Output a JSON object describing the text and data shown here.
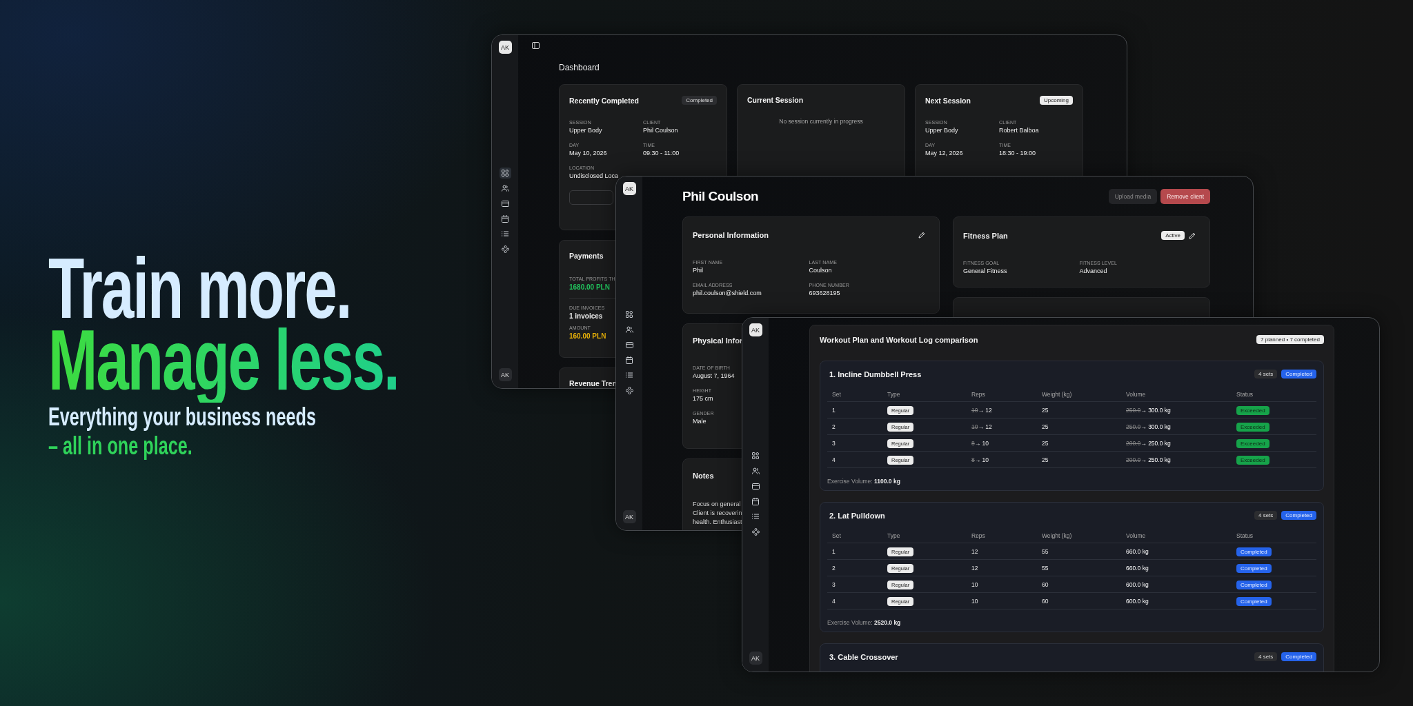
{
  "hero": {
    "headline": "Train more.",
    "headline_accent": "Manage less.",
    "tagline": "Everything your business needs",
    "tagline_accent": "– all in one place."
  },
  "dashboard_window": {
    "avatar": "AK",
    "footer_avatar": "AK",
    "nav": [
      {
        "kind": "grid",
        "selected": true
      },
      {
        "kind": "users",
        "selected": false
      },
      {
        "kind": "card",
        "selected": false
      },
      {
        "kind": "calendar",
        "selected": false
      },
      {
        "kind": "list",
        "selected": false
      },
      {
        "kind": "nodes",
        "selected": false
      }
    ],
    "title": "Dashboard",
    "session_cards": [
      {
        "title": "Recently Completed",
        "badge": {
          "label": "Completed",
          "kind": "neutral"
        },
        "fields": [
          {
            "label": "SESSION",
            "value": "Upper Body"
          },
          {
            "label": "CLIENT",
            "value": "Phil Coulson"
          },
          {
            "label": "DAY",
            "value": "May 10, 2026"
          },
          {
            "label": "TIME",
            "value": "09:30 - 11:00"
          },
          {
            "label": "LOCATION",
            "value": "Undisclosed Loca"
          }
        ],
        "action_button": true
      },
      {
        "title": "Current Session",
        "empty_text": "No session currently in progress"
      },
      {
        "title": "Next Session",
        "badge": {
          "label": "Upcoming",
          "kind": "light"
        },
        "fields": [
          {
            "label": "SESSION",
            "value": "Upper Body"
          },
          {
            "label": "CLIENT",
            "value": "Robert Balboa"
          },
          {
            "label": "DAY",
            "value": "May 12, 2026"
          },
          {
            "label": "TIME",
            "value": "18:30 - 19:00"
          }
        ]
      }
    ],
    "payments": {
      "title": "Payments",
      "groups": [
        [
          {
            "label": "TOTAL PROFITS TH",
            "value": "1680.00 PLN",
            "color": "#22c55e"
          }
        ],
        [
          {
            "label": "DUE INVOICES",
            "value": "1 invoices"
          },
          {
            "label": "AMOUNT",
            "value": "160.00 PLN",
            "color": "#eab308"
          }
        ]
      ]
    },
    "revenue": {
      "title": "Revenue Tren"
    }
  },
  "client_window": {
    "avatar": "AK",
    "footer_avatar": "AK",
    "nav": [
      {
        "kind": "grid",
        "selected": false
      },
      {
        "kind": "users",
        "selected": false
      },
      {
        "kind": "card",
        "selected": false
      },
      {
        "kind": "calendar",
        "selected": false
      },
      {
        "kind": "list",
        "selected": false
      },
      {
        "kind": "nodes",
        "selected": false
      }
    ],
    "title": "Phil Coulson",
    "buttons": [
      {
        "label": "Upload media",
        "kind": "secondary"
      },
      {
        "label": "Remove client",
        "kind": "danger"
      }
    ],
    "personal": {
      "title": "Personal Information",
      "fields": [
        {
          "label": "FIRST NAME",
          "value": "Phil"
        },
        {
          "label": "LAST NAME",
          "value": "Coulson"
        },
        {
          "label": "EMAIL ADDRESS",
          "value": "phil.coulson@shield.com"
        },
        {
          "label": "PHONE NUMBER",
          "value": "693628195"
        }
      ]
    },
    "fitness_plan": {
      "title": "Fitness Plan",
      "badge": {
        "label": "Active",
        "kind": "light"
      },
      "fields": [
        {
          "label": "FITNESS GOAL",
          "value": "General Fitness"
        },
        {
          "label": "FITNESS LEVEL",
          "value": "Advanced"
        }
      ]
    },
    "physical": {
      "title": "Physical Infor",
      "fields": [
        {
          "label": "DATE OF BIRTH",
          "value": "August 7, 1964"
        },
        {
          "label": "HEIGHT",
          "value": "175 cm"
        },
        {
          "label": "GENDER",
          "value": "Male"
        }
      ]
    },
    "notes": {
      "title": "Notes",
      "lines": [
        "Focus on general",
        "Client is recoverin",
        "health. Enthusiast"
      ]
    }
  },
  "workout_window": {
    "avatar": "AK",
    "footer_avatar": "AK",
    "nav": [
      {
        "kind": "grid",
        "selected": false
      },
      {
        "kind": "users",
        "selected": false
      },
      {
        "kind": "card",
        "selected": false
      },
      {
        "kind": "calendar",
        "selected": false
      },
      {
        "kind": "list",
        "selected": false
      },
      {
        "kind": "nodes",
        "selected": false
      }
    ],
    "title": "Workout Plan and Workout Log comparison",
    "summary_badge": "7 planned • 7 completed",
    "exercises": [
      {
        "title": "1. Incline Dumbbell Press",
        "sets_badge": "4 sets",
        "status_badge": "Completed",
        "columns": [
          "Set",
          "Type",
          "Reps",
          "Weight (kg)",
          "Volume",
          "Status"
        ],
        "rows": [
          {
            "set": "1",
            "type": "Regular",
            "reps_planned": "10",
            "reps": "→ 12",
            "weight": "25",
            "volume_planned": "250.0",
            "volume": "→ 300.0 kg",
            "status": {
              "label": "Exceeded",
              "kind": "success"
            }
          },
          {
            "set": "2",
            "type": "Regular",
            "reps_planned": "10",
            "reps": "→ 12",
            "weight": "25",
            "volume_planned": "250.0",
            "volume": "→ 300.0 kg",
            "status": {
              "label": "Exceeded",
              "kind": "success"
            }
          },
          {
            "set": "3",
            "type": "Regular",
            "reps_planned": "8",
            "reps": "→ 10",
            "weight": "25",
            "volume_planned": "200.0",
            "volume": "→ 250.0 kg",
            "status": {
              "label": "Exceeded",
              "kind": "success"
            }
          },
          {
            "set": "4",
            "type": "Regular",
            "reps_planned": "8",
            "reps": "→ 10",
            "weight": "25",
            "volume_planned": "200.0",
            "volume": "→ 250.0 kg",
            "status": {
              "label": "Exceeded",
              "kind": "success"
            }
          }
        ],
        "total": "Exercise Volume: **1100.0 kg**"
      },
      {
        "title": "2. Lat Pulldown",
        "sets_badge": "4 sets",
        "status_badge": "Completed",
        "columns": [
          "Set",
          "Type",
          "Reps",
          "Weight (kg)",
          "Volume",
          "Status"
        ],
        "rows": [
          {
            "set": "1",
            "type": "Regular",
            "reps": "12",
            "weight": "55",
            "volume": "660.0 kg",
            "status": {
              "label": "Completed",
              "kind": "info"
            }
          },
          {
            "set": "2",
            "type": "Regular",
            "reps": "12",
            "weight": "55",
            "volume": "660.0 kg",
            "status": {
              "label": "Completed",
              "kind": "info"
            }
          },
          {
            "set": "3",
            "type": "Regular",
            "reps": "10",
            "weight": "60",
            "volume": "600.0 kg",
            "status": {
              "label": "Completed",
              "kind": "info"
            }
          },
          {
            "set": "4",
            "type": "Regular",
            "reps": "10",
            "weight": "60",
            "volume": "600.0 kg",
            "status": {
              "label": "Completed",
              "kind": "info"
            }
          }
        ],
        "total": "Exercise Volume: **2520.0 kg**"
      },
      {
        "title": "3. Cable Crossover",
        "sets_badge": "4 sets",
        "status_badge": "Completed"
      }
    ]
  }
}
